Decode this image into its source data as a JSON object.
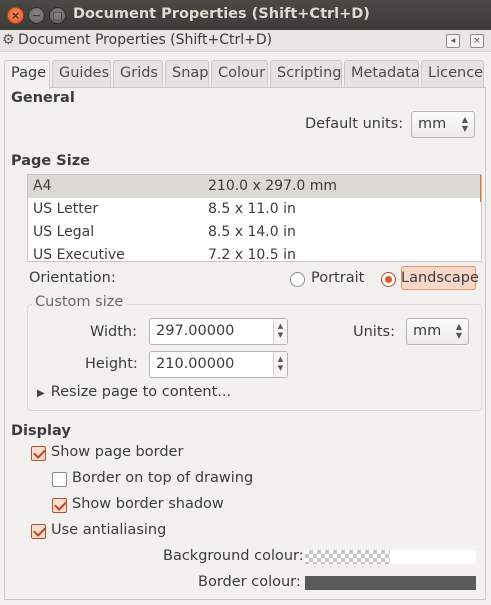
{
  "window": {
    "title": "Document Properties (Shift+Ctrl+D)",
    "controls": {
      "close": "×",
      "minimize": "−",
      "maximize": "□"
    }
  },
  "dock": {
    "title": "Document Properties (Shift+Ctrl+D)",
    "icon": "gear-icon",
    "buttons": [
      "◂",
      "×"
    ]
  },
  "tabs": [
    {
      "label": "Page",
      "active": true
    },
    {
      "label": "Guides"
    },
    {
      "label": "Grids"
    },
    {
      "label": "Snap"
    },
    {
      "label": "Colour"
    },
    {
      "label": "Scripting"
    },
    {
      "label": "Metadata"
    },
    {
      "label": "Licence"
    }
  ],
  "general": {
    "heading": "General",
    "default_units_label": "Default units:",
    "default_units_value": "mm"
  },
  "page_size": {
    "heading": "Page Size",
    "rows": [
      {
        "name": "A4",
        "size": "210.0 x 297.0 mm",
        "selected": true
      },
      {
        "name": "US Letter",
        "size": "8.5 x 11.0 in"
      },
      {
        "name": "US Legal",
        "size": "8.5 x 14.0 in"
      },
      {
        "name": "US Executive",
        "size": "7.2 x 10.5 in"
      }
    ]
  },
  "orientation": {
    "label": "Orientation:",
    "portrait": "Portrait",
    "landscape": "Landscape",
    "selected": "Landscape"
  },
  "custom_size": {
    "title": "Custom size",
    "width_label": "Width:",
    "width_value": "297.00000",
    "height_label": "Height:",
    "height_value": "210.00000",
    "units_label": "Units:",
    "units_value": "mm",
    "resize_label": "Resize page to content..."
  },
  "display": {
    "heading": "Display",
    "show_page_border": "Show page border",
    "border_on_top": "Border on top of drawing",
    "show_border_shadow": "Show border shadow",
    "use_antialiasing": "Use antialiasing",
    "background_colour_label": "Background colour:",
    "border_colour_label": "Border colour:",
    "checks": {
      "show_page_border": true,
      "border_on_top": false,
      "show_border_shadow": true,
      "use_antialiasing": true
    },
    "border_colour": "#5a5a5a"
  },
  "colors": {
    "accent": "#e05a25",
    "titlebar": "#3c3b37",
    "window_bg": "#f2f1f0"
  }
}
